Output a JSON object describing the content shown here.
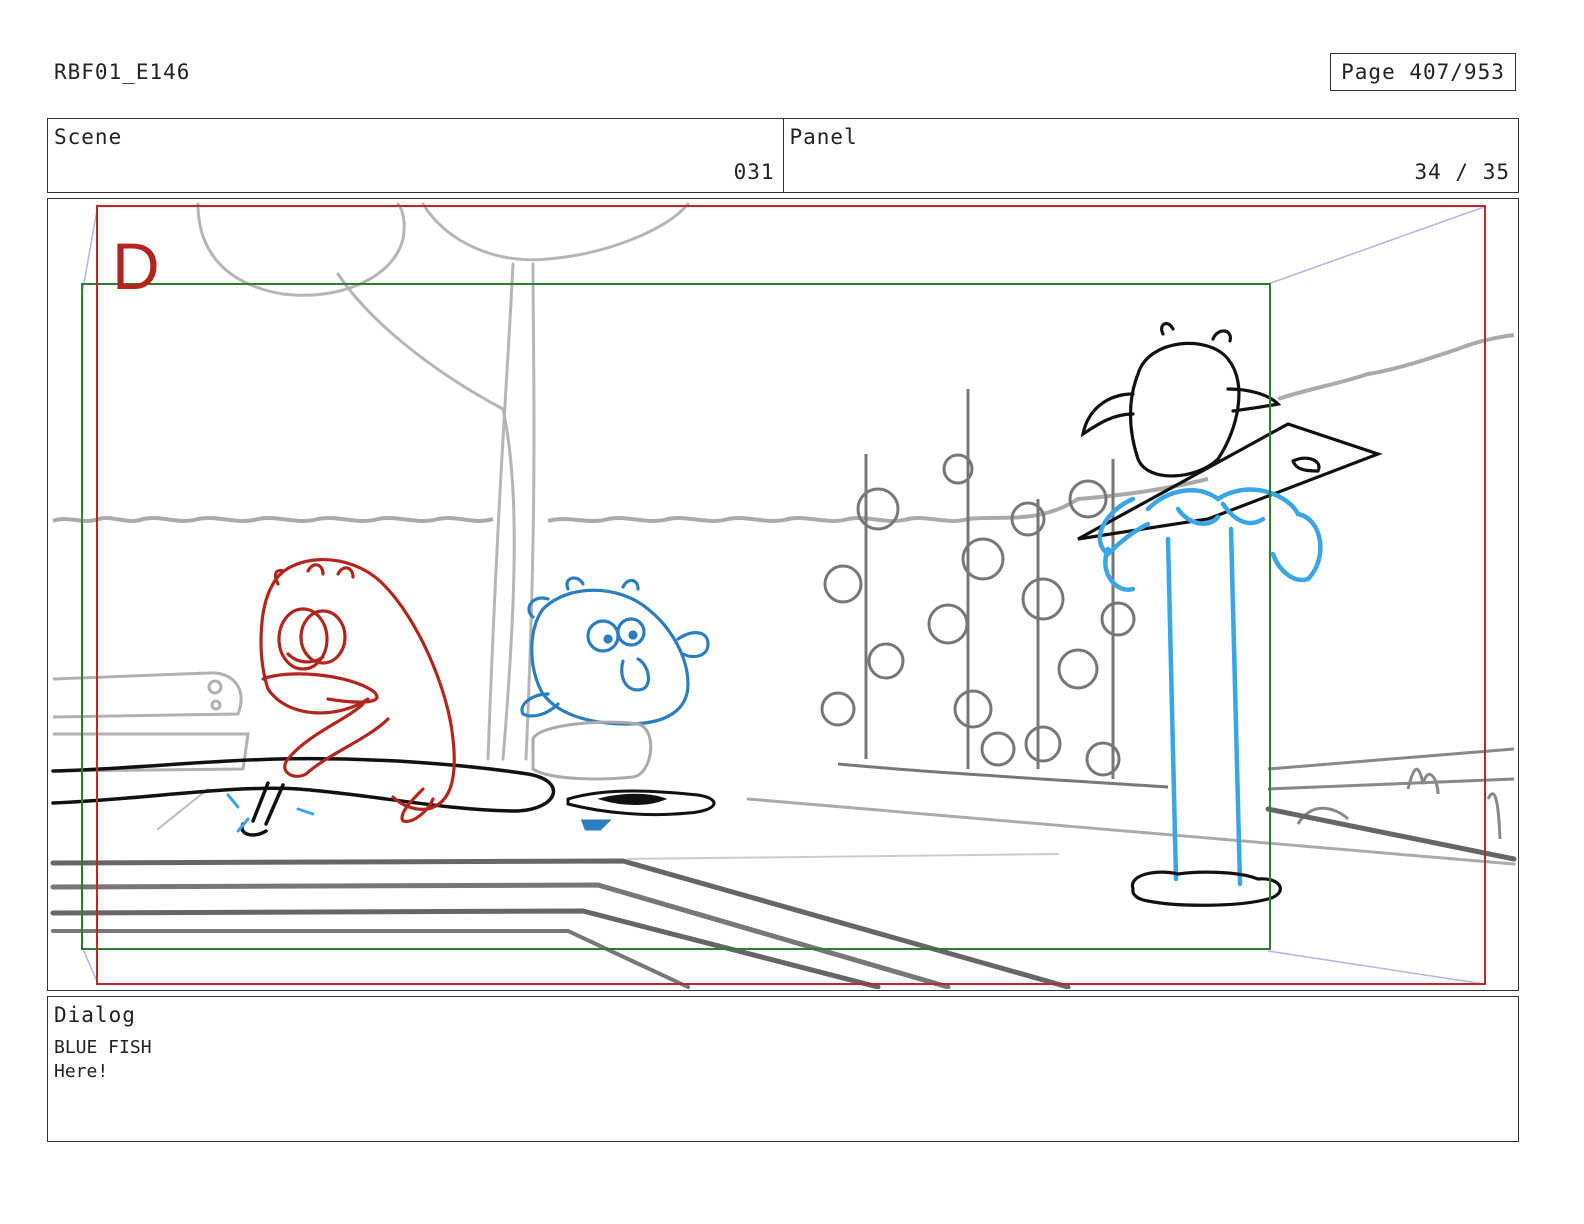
{
  "header": {
    "project_code": "RBF01_E146",
    "page_label": "Page 407/953"
  },
  "scene": {
    "label": "Scene",
    "value": "031"
  },
  "panel": {
    "label": "Panel",
    "value": "34 / 35"
  },
  "artwork": {
    "frame_marker": "D",
    "colors": {
      "safe_frame_red": "#c0272d",
      "action_frame_green": "#2e7d32",
      "red_character": "#b3261e",
      "blue_character": "#2b7fbf",
      "splash_blue": "#3aa6e8",
      "background_gray": "#9e9e9e",
      "ink": "#111111"
    }
  },
  "dialog": {
    "label": "Dialog",
    "speaker": "BLUE FISH",
    "line": "Here!"
  }
}
